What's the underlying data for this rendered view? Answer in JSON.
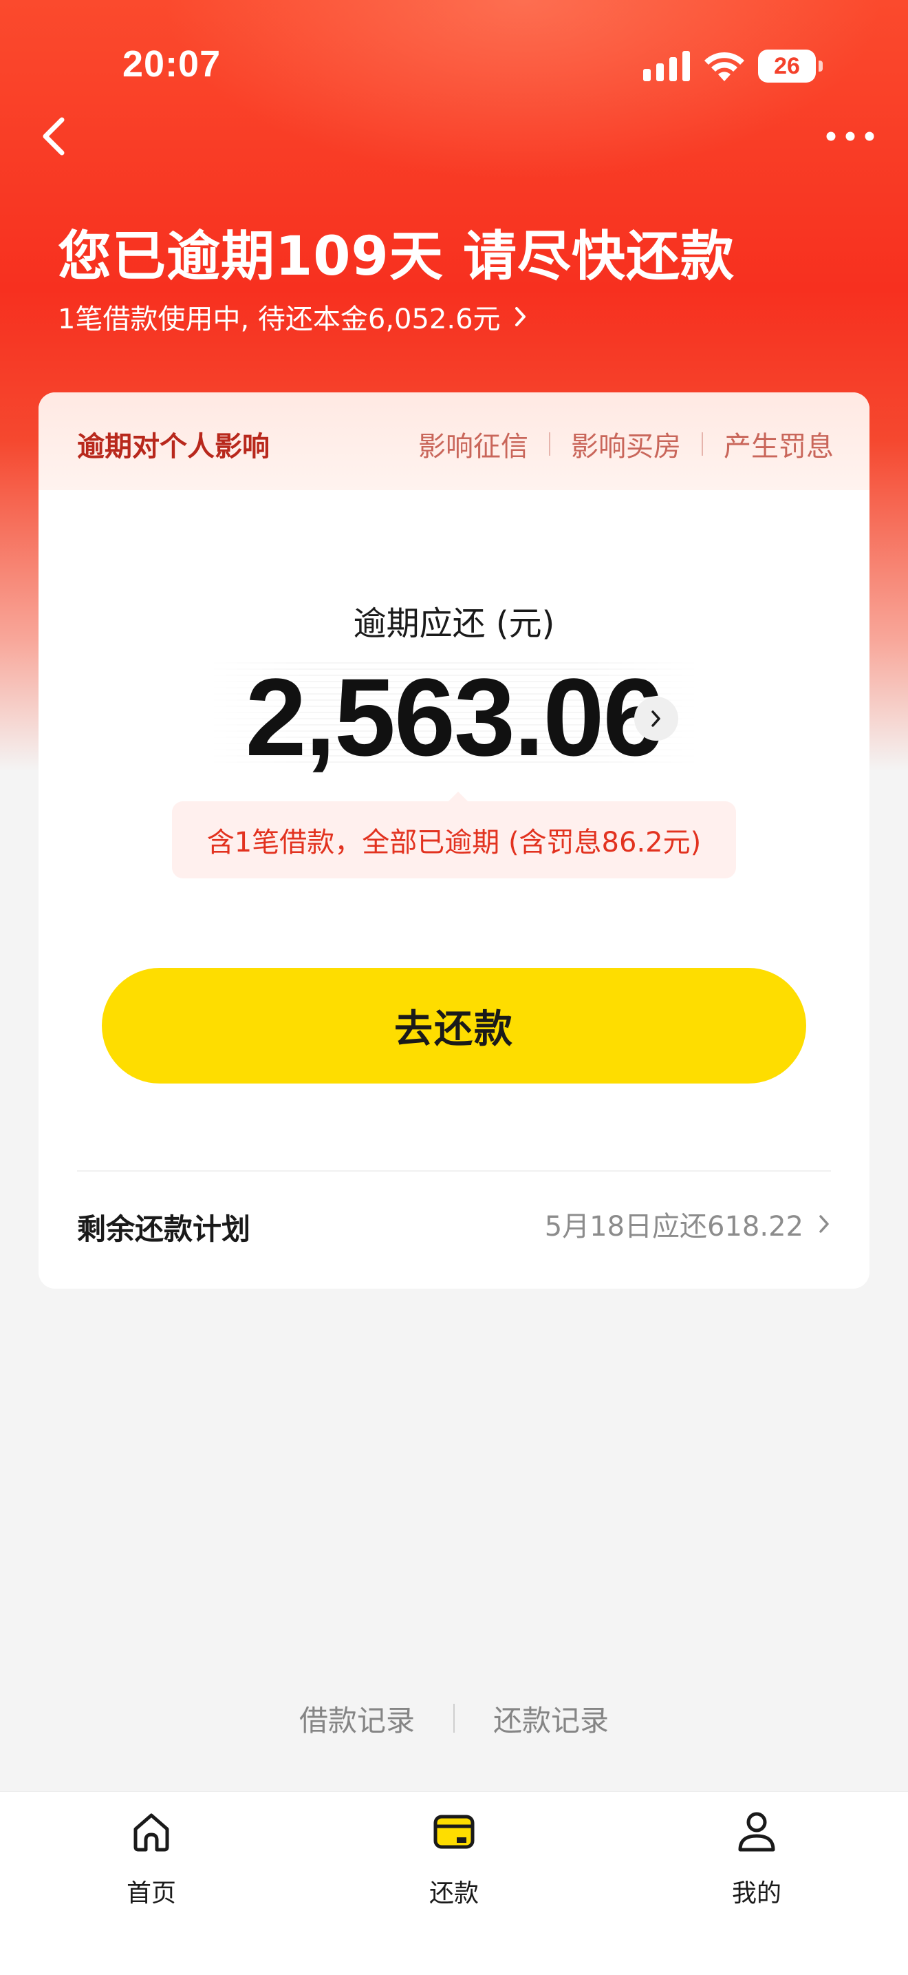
{
  "status_bar": {
    "time": "20:07",
    "battery": "26"
  },
  "header": {
    "title": "您已逾期109天 请尽快还款",
    "subtitle": "1笔借款使用中, 待还本金6,052.6元"
  },
  "impact": {
    "title": "逾期对个人影响",
    "tags": [
      "影响征信",
      "影响买房",
      "产生罚息"
    ]
  },
  "amount": {
    "label": "逾期应还 (元)",
    "value": "2,563.06",
    "note": "含1笔借款，全部已逾期 (含罚息86.2元)"
  },
  "repay_button": {
    "label": "去还款",
    "color": "#fedd00"
  },
  "plan": {
    "label": "剩余还款计划",
    "value": "5月18日应还618.22"
  },
  "records": {
    "loan_label": "借款记录",
    "repay_label": "还款记录"
  },
  "tabs": [
    {
      "label": "首页",
      "icon": "home-icon"
    },
    {
      "label": "还款",
      "icon": "wallet-icon",
      "active": true
    },
    {
      "label": "我的",
      "icon": "user-icon"
    }
  ],
  "colors": {
    "header_red": "#f7301f",
    "accent_red": "#e2321f",
    "accent_yellow": "#fedd00"
  }
}
